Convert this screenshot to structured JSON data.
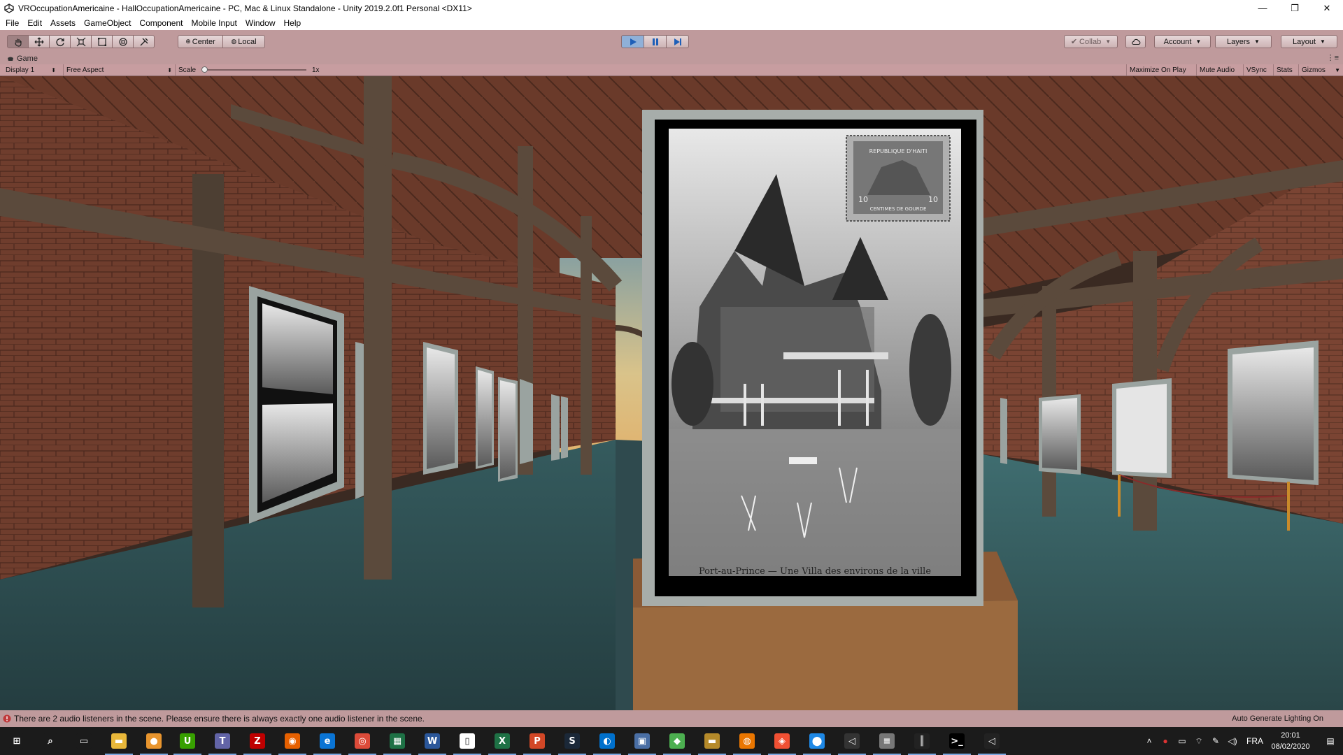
{
  "window": {
    "title": "VROccupationAmericaine - HallOccupationAmericaine - PC, Mac & Linux Standalone - Unity 2019.2.0f1 Personal <DX11>",
    "minimize": "—",
    "maximize": "❐",
    "close": "✕"
  },
  "menu": [
    "File",
    "Edit",
    "Assets",
    "GameObject",
    "Component",
    "Mobile Input",
    "Window",
    "Help"
  ],
  "toolbar": {
    "tools": [
      {
        "name": "hand-tool",
        "icon": "hand-icon"
      },
      {
        "name": "move-tool",
        "icon": "move-icon"
      },
      {
        "name": "rotate-tool",
        "icon": "rotate-icon"
      },
      {
        "name": "scale-tool",
        "icon": "scale-icon"
      },
      {
        "name": "rect-tool",
        "icon": "rect-icon"
      },
      {
        "name": "transform-tool",
        "icon": "transform-icon"
      },
      {
        "name": "custom-tool",
        "icon": "custom-tool-icon"
      }
    ],
    "pivot_label": "Center",
    "space_label": "Local",
    "play": {
      "playing": true,
      "paused": true
    },
    "collab_label": "Collab",
    "account_label": "Account",
    "layers_label": "Layers",
    "layout_label": "Layout"
  },
  "game_tab": {
    "label": "Game"
  },
  "game_view": {
    "display_label": "Display 1",
    "aspect_label": "Free Aspect",
    "scale_label": "Scale",
    "scale_value": "1x",
    "maximize_on_play": "Maximize On Play",
    "mute_audio": "Mute Audio",
    "vsync": "VSync",
    "stats": "Stats",
    "gizmos": "Gizmos"
  },
  "scene": {
    "postcard_caption": "Port-au-Prince — Une Villa des environs de la ville",
    "stamp_text": "REPUBLIQUE D'HAITI",
    "stamp_value": "10",
    "stamp_denomination": "CENTIMES DE GOURDE",
    "colors": {
      "brick": "#6b3a2c",
      "wood": "#5a4a3c",
      "floor": "#2f4a4e",
      "frame": "#9aa3a0",
      "sky": "#d9c38a"
    }
  },
  "status": {
    "message": "There are 2 audio listeners in the scene. Please ensure there is always exactly one audio listener in the scene.",
    "right_text": "Auto Generate Lighting On"
  },
  "taskbar": {
    "apps": [
      {
        "name": "start-icon",
        "color": "#1b1b1b",
        "glyph": "⊞"
      },
      {
        "name": "search-icon",
        "color": "#1b1b1b",
        "glyph": "⌕"
      },
      {
        "name": "task-view-icon",
        "color": "#1b1b1b",
        "glyph": "▭"
      },
      {
        "name": "file-explorer-icon",
        "color": "#e8b73a",
        "glyph": "▬"
      },
      {
        "name": "app-orange-icon",
        "color": "#e8952e",
        "glyph": "●"
      },
      {
        "name": "upwork-icon",
        "color": "#37a000",
        "glyph": "U"
      },
      {
        "name": "teams-icon",
        "color": "#6264a7",
        "glyph": "T"
      },
      {
        "name": "filezilla-icon",
        "color": "#bf0000",
        "glyph": "Z"
      },
      {
        "name": "firefox-icon",
        "color": "#e66000",
        "glyph": "◉"
      },
      {
        "name": "edge-icon",
        "color": "#0a74d4",
        "glyph": "e"
      },
      {
        "name": "chrome-icon",
        "color": "#dd4b39",
        "glyph": "◎"
      },
      {
        "name": "excel-file-icon",
        "color": "#1e7145",
        "glyph": "▦"
      },
      {
        "name": "word-icon",
        "color": "#2b579a",
        "glyph": "W"
      },
      {
        "name": "notepad-icon",
        "color": "#ffffff",
        "glyph": "▯"
      },
      {
        "name": "excel-icon",
        "color": "#1e7145",
        "glyph": "X"
      },
      {
        "name": "powerpoint-icon",
        "color": "#d24726",
        "glyph": "P"
      },
      {
        "name": "steam-icon",
        "color": "#1b2838",
        "glyph": "S"
      },
      {
        "name": "ubisoft-icon",
        "color": "#0070cc",
        "glyph": "◐"
      },
      {
        "name": "monitor-icon",
        "color": "#4a6fa5",
        "glyph": "▣"
      },
      {
        "name": "app-green-icon",
        "color": "#4caf50",
        "glyph": "◆"
      },
      {
        "name": "folder-dark-icon",
        "color": "#b58a2a",
        "glyph": "▬"
      },
      {
        "name": "blender-icon",
        "color": "#ea7600",
        "glyph": "◍"
      },
      {
        "name": "git-icon",
        "color": "#f05033",
        "glyph": "◈"
      },
      {
        "name": "maps-icon",
        "color": "#1e88e5",
        "glyph": "⬤"
      },
      {
        "name": "unity-hub-icon",
        "color": "#333333",
        "glyph": "◁"
      },
      {
        "name": "database-icon",
        "color": "#777777",
        "glyph": "≡"
      },
      {
        "name": "graph-app-icon",
        "color": "#222222",
        "glyph": "║"
      },
      {
        "name": "terminal-icon",
        "color": "#000000",
        "glyph": ">_"
      },
      {
        "name": "unity-icon",
        "color": "#222222",
        "glyph": "◁"
      }
    ],
    "tray": {
      "language": "FRA",
      "time": "20:01",
      "date": "08/02/2020"
    }
  }
}
